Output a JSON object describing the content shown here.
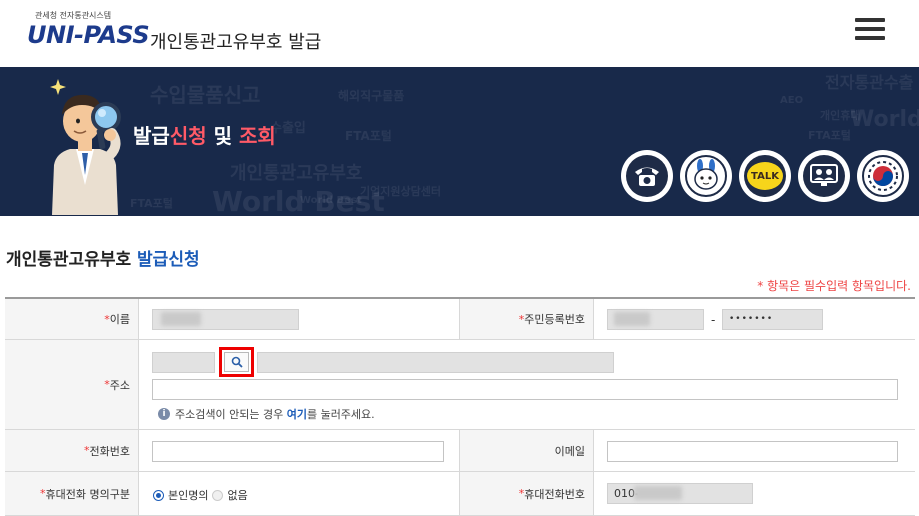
{
  "header": {
    "logo_small": "관세청 전자통관시스템",
    "logo_main_left": "UNI-PASS",
    "title": "개인통관고유부호  발급",
    "menu_icon": "hamburger-menu-icon"
  },
  "banner": {
    "title_part1": "발급",
    "title_part2": "신청",
    "title_part3": " 및 ",
    "title_part4": "조회",
    "bg_words": [
      "수입물품신고",
      "해외직구물품",
      "개인통관고유부호",
      "World Best",
      "FTA포털",
      "기업지원상담센터",
      "전자통관수출",
      "개인휴대",
      "FTA포털",
      "World",
      "AEO",
      "FTA포털",
      "World Best",
      "수출입"
    ],
    "service_icons": [
      "phone-icon",
      "mascot-icon",
      "kakao-talk-icon",
      "video-consult-icon",
      "government-emblem-icon"
    ],
    "kakao_label": "TALK"
  },
  "page": {
    "heading_black": "개인통관고유부호",
    "heading_blue": " 발급신청",
    "required_note": "* 항목은 필수입력 항목입니다."
  },
  "form": {
    "name_label": "이름",
    "rrn_label": "주민등록번호",
    "rrn_dash": "-",
    "rrn_back": "•••••••",
    "address_label": "주소",
    "address_info_pre": "주소검색이 안되는 경우 ",
    "address_info_link": "여기",
    "address_info_post": "를 눌러주세요.",
    "phone_label": "전화번호",
    "email_label": "이메일",
    "mobile_owner_label": "휴대전화 명의구분",
    "owner_options": [
      "본인명의",
      "없음"
    ],
    "owner_selected": "본인명의",
    "mobile_label": "휴대전화번호",
    "mobile_prefix": "010-",
    "required_mark": "*"
  },
  "colors": {
    "banner_bg": "#18294a",
    "accent_red": "#ff5a67",
    "brand_blue": "#1c5cb8",
    "highlight_box": "#ee0000"
  }
}
